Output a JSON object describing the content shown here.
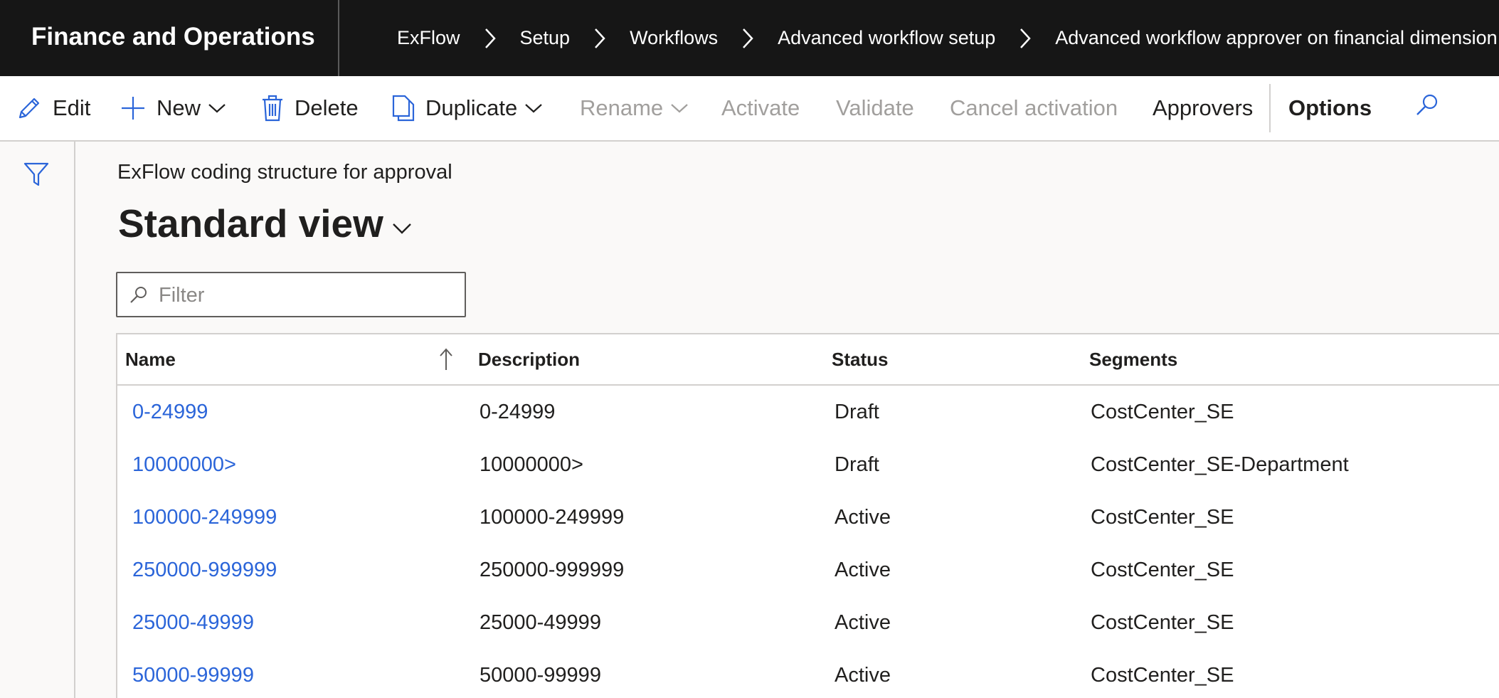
{
  "app": {
    "title": "Finance and Operations"
  },
  "breadcrumb": [
    "ExFlow",
    "Setup",
    "Workflows",
    "Advanced workflow setup",
    "Advanced workflow approver on financial dimension"
  ],
  "actions": {
    "edit": "Edit",
    "new": "New",
    "delete": "Delete",
    "duplicate": "Duplicate",
    "rename": "Rename",
    "activate": "Activate",
    "validate": "Validate",
    "cancel_activation": "Cancel activation",
    "approvers": "Approvers",
    "options": "Options"
  },
  "icons": {
    "edit": "pencil-icon",
    "new": "plus-icon",
    "delete": "trash-icon",
    "duplicate": "copy-icon",
    "search": "search-icon",
    "filter": "funnel-icon"
  },
  "page": {
    "caption": "ExFlow coding structure for approval",
    "view_title": "Standard view"
  },
  "filter": {
    "placeholder": "Filter",
    "value": ""
  },
  "grid": {
    "columns": [
      "Name",
      "Description",
      "Status",
      "Segments"
    ],
    "sort_column": "Name",
    "rows": [
      {
        "name": "0-24999",
        "description": "0-24999",
        "status": "Draft",
        "segments": "CostCenter_SE"
      },
      {
        "name": "10000000>",
        "description": "10000000>",
        "status": "Draft",
        "segments": "CostCenter_SE-Department"
      },
      {
        "name": "100000-249999",
        "description": "100000-249999",
        "status": "Active",
        "segments": "CostCenter_SE"
      },
      {
        "name": "250000-999999",
        "description": "250000-999999",
        "status": "Active",
        "segments": "CostCenter_SE"
      },
      {
        "name": "25000-49999",
        "description": "25000-49999",
        "status": "Active",
        "segments": "CostCenter_SE"
      },
      {
        "name": "50000-99999",
        "description": "50000-99999",
        "status": "Active",
        "segments": "CostCenter_SE"
      }
    ]
  },
  "colors": {
    "topbar": "#161616",
    "link": "#2b65d9",
    "accent": "#2b65d9",
    "disabled": "#a19f9d"
  }
}
